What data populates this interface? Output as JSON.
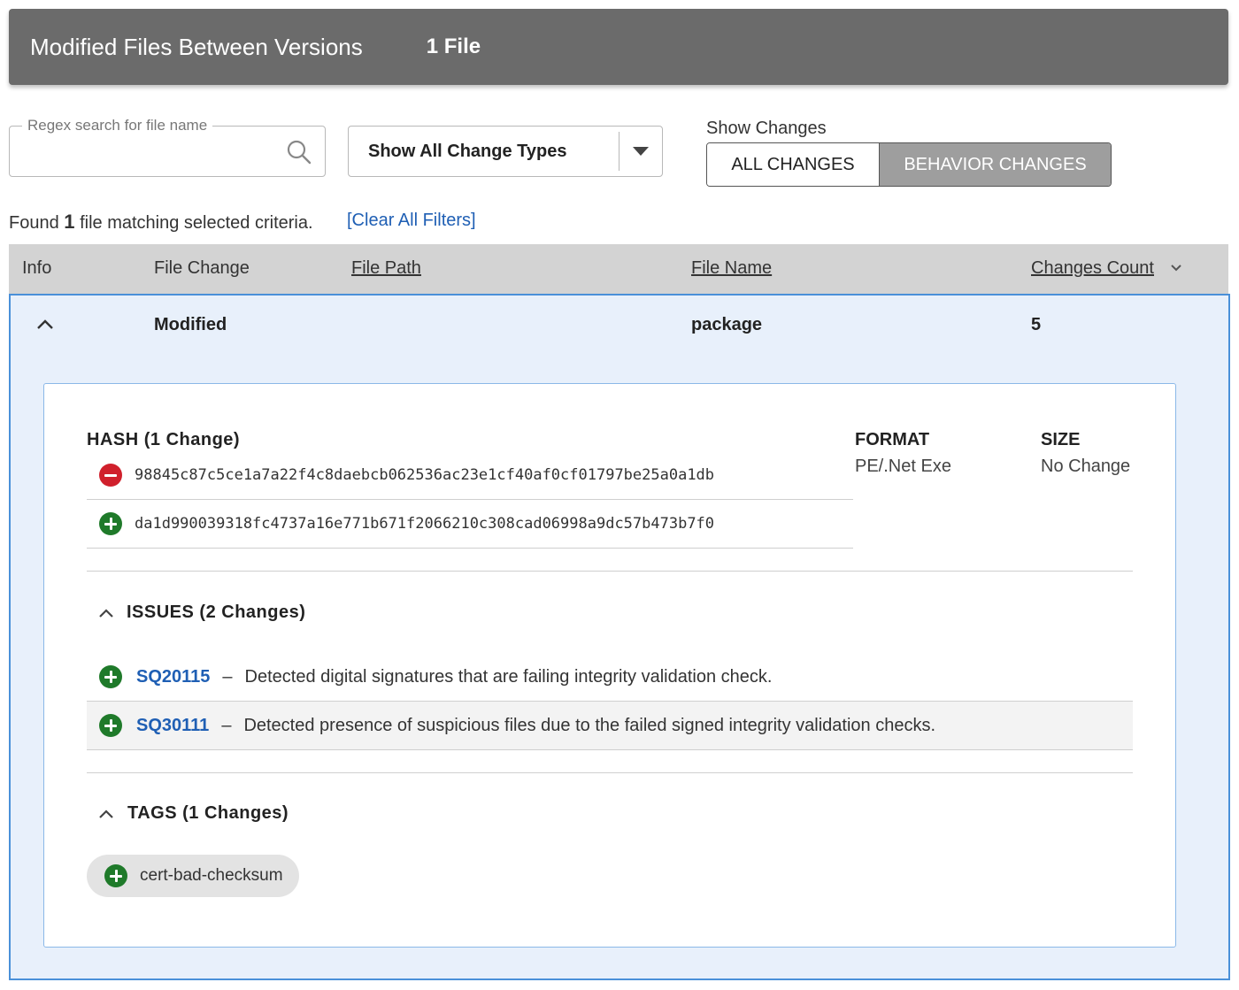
{
  "header": {
    "title": "Modified Files Between Versions",
    "count": "1 File"
  },
  "filters": {
    "search_legend": "Regex search for file name",
    "search_value": "",
    "change_type_selected": "Show All Change Types",
    "show_changes_label": "Show Changes",
    "toggle": {
      "all": "ALL CHANGES",
      "behavior": "BEHAVIOR CHANGES",
      "active": "behavior"
    }
  },
  "results": {
    "found_prefix": "Found",
    "found_count": "1",
    "found_suffix": "file matching selected criteria.",
    "clear_filters": "[Clear All Filters]"
  },
  "table": {
    "columns": {
      "info": "Info",
      "file_change": "File Change",
      "file_path": "File Path",
      "file_name": "File Name",
      "changes_count": "Changes Count"
    },
    "row": {
      "file_change": "Modified",
      "file_path": "",
      "file_name": "package",
      "changes_count": "5"
    }
  },
  "detail": {
    "hash": {
      "title": "HASH (1 Change)",
      "removed": "98845c87c5ce1a7a22f4c8daebcb062536ac23e1cf40af0cf01797be25a0a1db",
      "added": "da1d990039318fc4737a16e771b671f2066210c308cad06998a9dc57b473b7f0"
    },
    "format": {
      "label": "FORMAT",
      "value": "PE/.Net Exe"
    },
    "size": {
      "label": "SIZE",
      "value": "No Change"
    },
    "issues": {
      "title": "ISSUES (2 Changes)",
      "items": [
        {
          "code": "SQ20115",
          "desc": "Detected digital signatures that are failing integrity validation check."
        },
        {
          "code": "SQ30111",
          "desc": "Detected presence of suspicious files due to the failed signed integrity validation checks."
        }
      ]
    },
    "tags": {
      "title": "TAGS (1 Changes)",
      "items": [
        "cert-bad-checksum"
      ]
    }
  },
  "colors": {
    "header_bg": "#6b6b6b",
    "accent_blue": "#1f5fb4",
    "added": "#1f7a2a",
    "removed": "#d0202c",
    "row_bg": "#e8f0fb"
  },
  "icons": [
    "search-icon",
    "dropdown-caret-icon",
    "chevron-down-icon",
    "chevron-up-icon",
    "minus-circle-icon",
    "plus-circle-icon"
  ]
}
